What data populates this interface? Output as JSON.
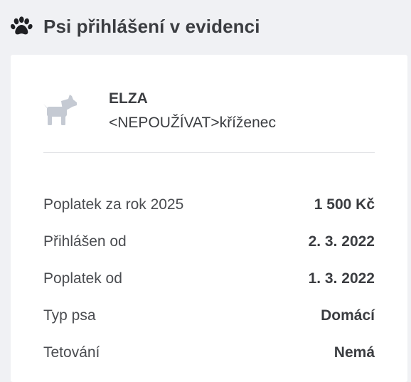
{
  "header": {
    "title": "Psi přihlášení v evidenci",
    "icon": "paw-icon"
  },
  "dog": {
    "icon": "dog-icon",
    "name": "ELZA",
    "breed": "<NEPOUŽÍVAT>kříženec"
  },
  "details": [
    {
      "label": "Poplatek za rok 2025",
      "value": "1 500 Kč"
    },
    {
      "label": "Přihlášen od",
      "value": "2. 3. 2022"
    },
    {
      "label": "Poplatek od",
      "value": "1. 3. 2022"
    },
    {
      "label": "Typ psa",
      "value": "Domácí"
    },
    {
      "label": "Tetování",
      "value": "Nemá"
    }
  ],
  "colors": {
    "background": "#f0f1f4",
    "card": "#ffffff",
    "text": "#3b3d41",
    "icon_muted": "#c5cad3"
  }
}
